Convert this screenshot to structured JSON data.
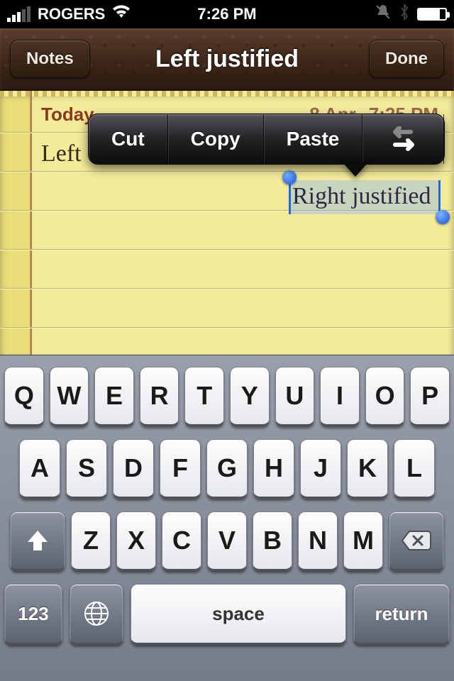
{
  "status": {
    "carrier": "ROGERS",
    "time": "7:26 PM"
  },
  "nav": {
    "back": "Notes",
    "title": "Left justified",
    "done": "Done"
  },
  "note": {
    "meta_today": "Today",
    "meta_date": "8 Apr",
    "meta_time": "7:25 PM",
    "line1": "Left",
    "selection": "Right justified"
  },
  "editmenu": {
    "cut": "Cut",
    "copy": "Copy",
    "paste": "Paste"
  },
  "keyboard": {
    "row1": [
      "Q",
      "W",
      "E",
      "R",
      "T",
      "Y",
      "U",
      "I",
      "O",
      "P"
    ],
    "row2": [
      "A",
      "S",
      "D",
      "F",
      "G",
      "H",
      "J",
      "K",
      "L"
    ],
    "row3": [
      "Z",
      "X",
      "C",
      "V",
      "B",
      "N",
      "M"
    ],
    "numkey": "123",
    "space": "space",
    "return": "return"
  }
}
